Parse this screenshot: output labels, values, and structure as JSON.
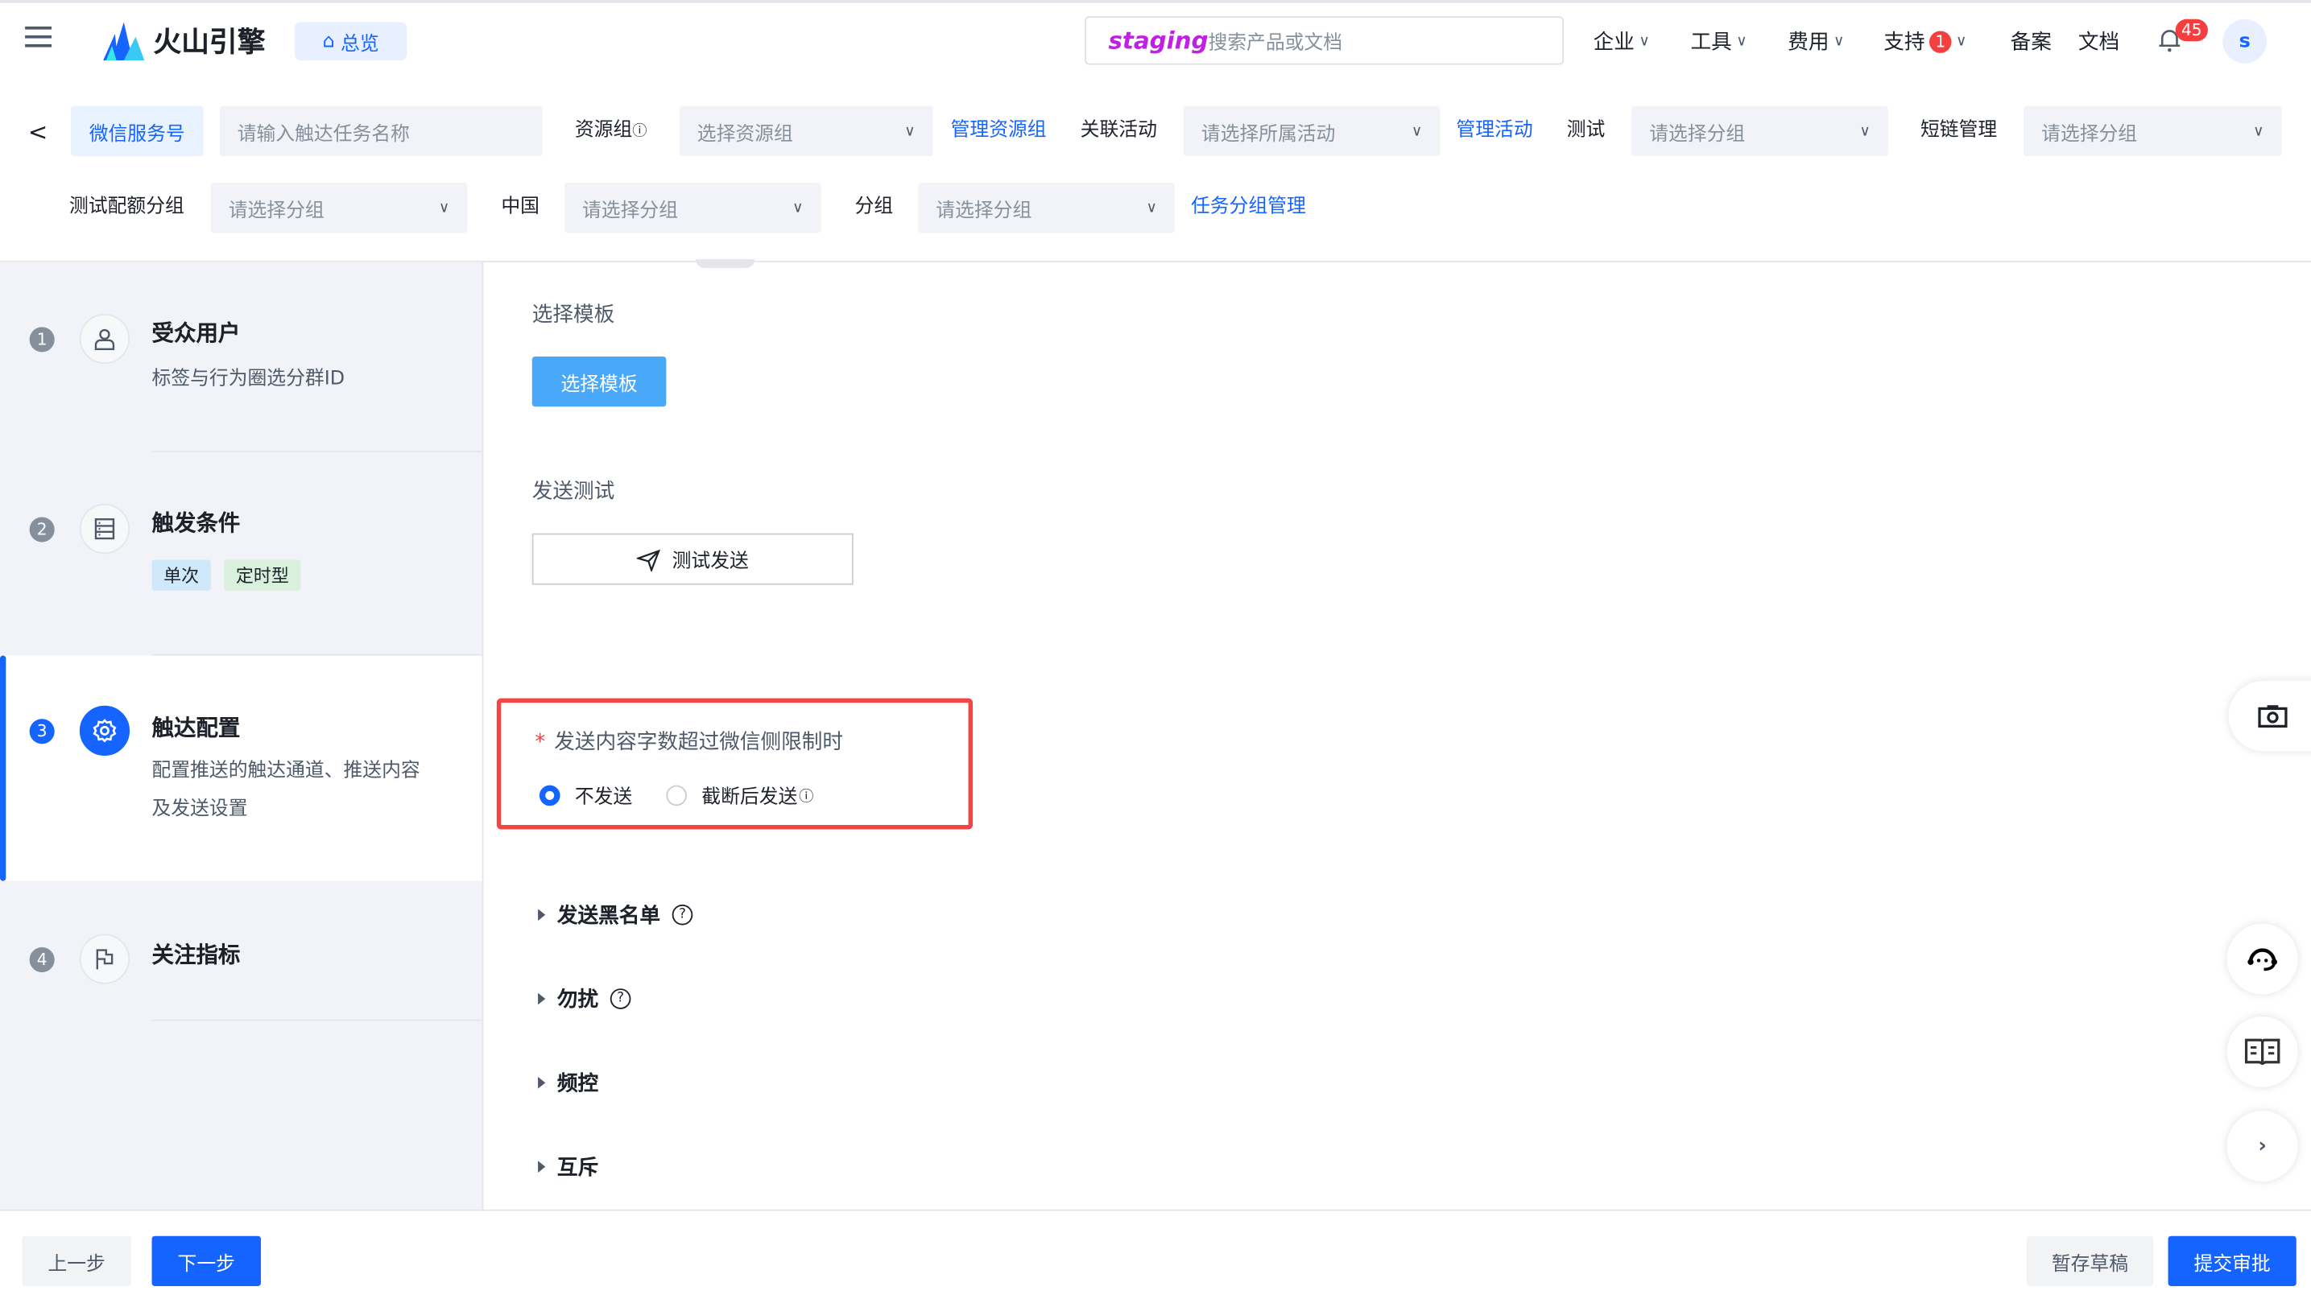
{
  "header": {
    "logo_text": "火山引擎",
    "overview": "总览",
    "search_overlay": "staging",
    "search_placeholder": "搜索产品或文档",
    "nav": [
      {
        "label": "企业"
      },
      {
        "label": "工具"
      },
      {
        "label": "费用"
      },
      {
        "label": "支持",
        "badge": "1"
      },
      {
        "label": "备案"
      },
      {
        "label": "文档"
      }
    ],
    "notification_count": "45",
    "avatar": "s"
  },
  "filters": {
    "tab": "微信服务号",
    "task_name_placeholder": "请输入触达任务名称",
    "resource_group_label": "资源组",
    "resource_group_placeholder": "选择资源组",
    "manage_resource_group": "管理资源组",
    "activity_label": "关联活动",
    "activity_placeholder": "请选择所属活动",
    "manage_activity": "管理活动",
    "test_label": "测试",
    "test_placeholder": "请选择分组",
    "shortlink_label": "短链管理",
    "shortlink_placeholder": "请选择分组",
    "quota_label": "测试配额分组",
    "quota_placeholder": "请选择分组",
    "china_label": "中国",
    "china_placeholder": "请选择分组",
    "group_label": "分组",
    "group_placeholder": "请选择分组",
    "task_group_manage": "任务分组管理"
  },
  "steps": [
    {
      "num": "1",
      "title": "受众用户",
      "desc": "标签与行为圈选分群ID",
      "icon": "user-icon"
    },
    {
      "num": "2",
      "title": "触发条件",
      "tags": [
        "单次",
        "定时型"
      ],
      "icon": "list-icon"
    },
    {
      "num": "3",
      "title": "触达配置",
      "desc1": "配置推送的触达通道、推送内容",
      "desc2": "及发送设置",
      "icon": "gear-icon",
      "active": true
    },
    {
      "num": "4",
      "title": "关注指标",
      "icon": "flag-icon"
    }
  ],
  "main": {
    "template_label": "选择模板",
    "template_button": "选择模板",
    "test_label": "发送测试",
    "test_button": "测试发送",
    "limit_question": "发送内容字数超过微信侧限制时",
    "required_mark": "*",
    "options": [
      {
        "label": "不发送",
        "selected": true
      },
      {
        "label": "截断后发送",
        "selected": false
      }
    ],
    "sections": [
      "发送黑名单",
      "勿扰",
      "频控",
      "互斥"
    ]
  },
  "footer": {
    "prev": "上一步",
    "next": "下一步",
    "save_draft": "暂存草稿",
    "submit": "提交审批"
  },
  "colors": {
    "primary": "#1664ff",
    "template_button": "#4aa8fb",
    "highlight_box": "#f44545",
    "sidebar_bg": "#f2f3f8"
  }
}
